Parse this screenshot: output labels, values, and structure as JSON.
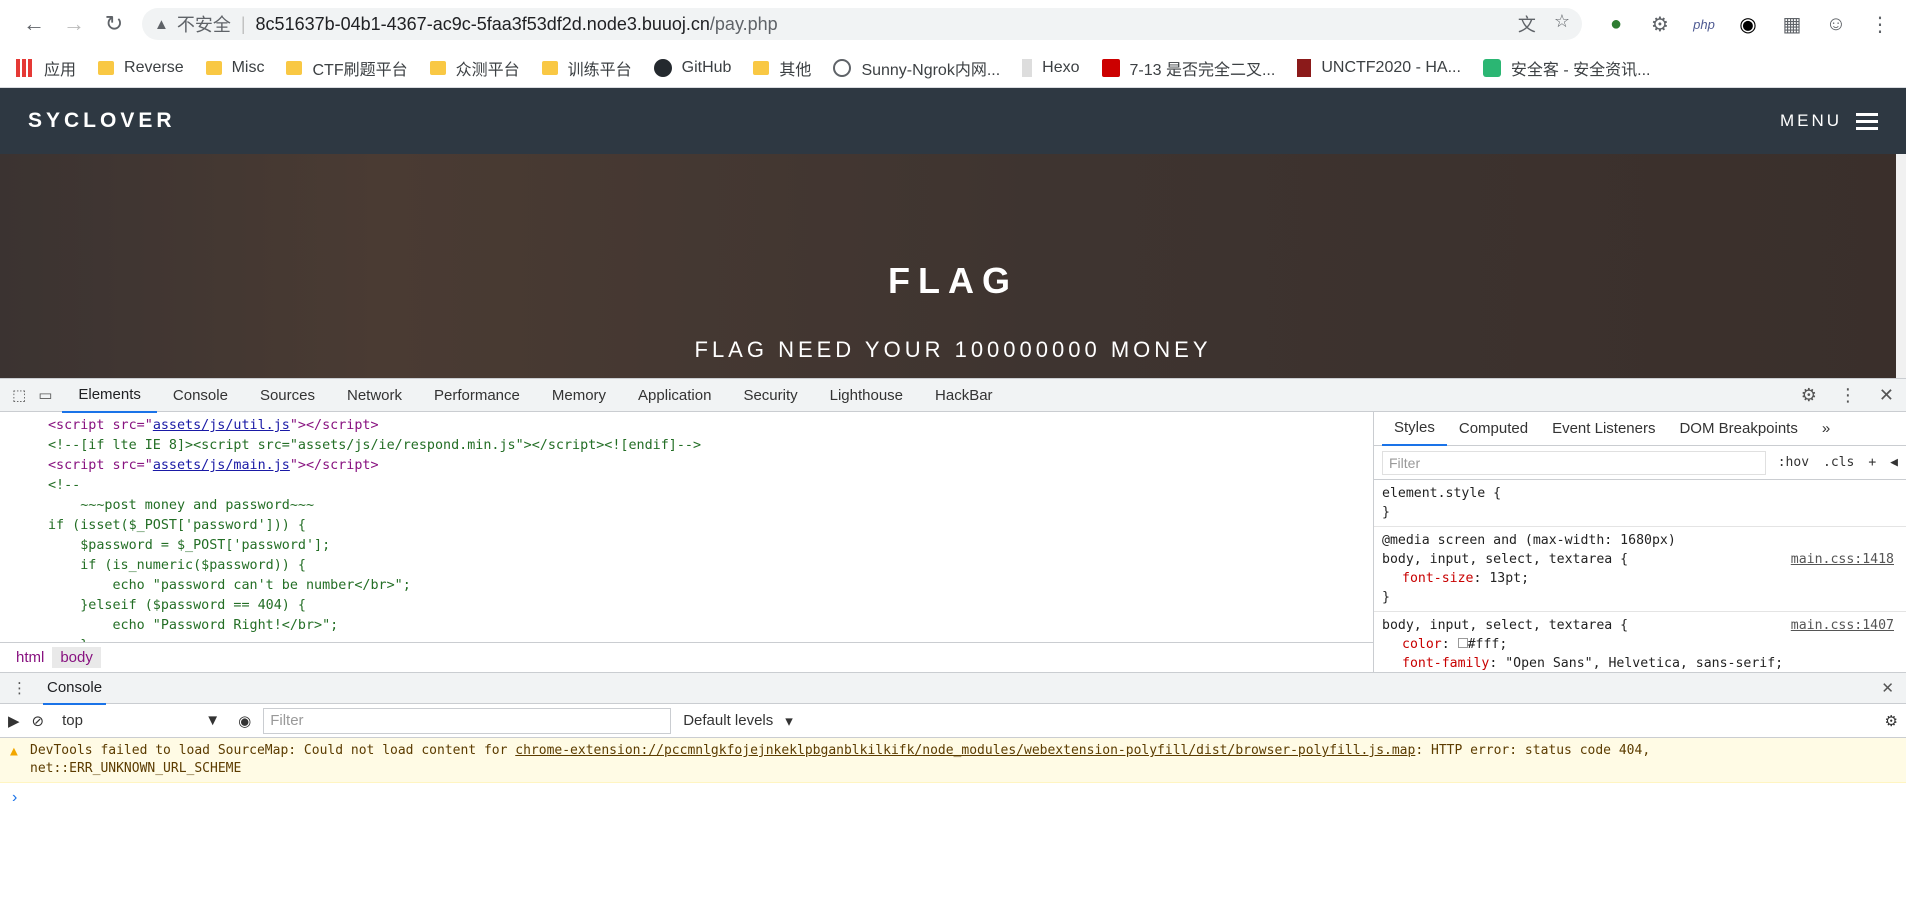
{
  "browser": {
    "insecure_label": "不安全",
    "url_host": "8c51637b-04b1-4367-ac9c-5faa3f53df2d.node3.buuoj.cn",
    "url_path": "/pay.php",
    "bookmarks": [
      "应用",
      "Reverse",
      "Misc",
      "CTF刷题平台",
      "众测平台",
      "训练平台",
      "GitHub",
      "其他",
      "Sunny-Ngrok内网...",
      "Hexo",
      "7-13 是否完全二叉...",
      "UNCTF2020 - HA...",
      "安全客 - 安全资讯..."
    ]
  },
  "site": {
    "logo": "SYCLOVER",
    "menu": "MENU",
    "title": "FLAG",
    "subtitle": "FLAG NEED YOUR 100000000 MONEY"
  },
  "devtools": {
    "tabs": [
      "Elements",
      "Console",
      "Sources",
      "Network",
      "Performance",
      "Memory",
      "Application",
      "Security",
      "Lighthouse",
      "HackBar"
    ],
    "breadcrumbs": [
      "html",
      "body"
    ],
    "styles_tabs": [
      "Styles",
      "Computed",
      "Event Listeners",
      "DOM Breakpoints"
    ],
    "styles_filter_placeholder": "Filter",
    "hov": ":hov",
    "cls": ".cls",
    "element_style": "element.style {",
    "media": "@media screen and (max-width: 1680px)",
    "rule1_selector": "body, input, select, textarea {",
    "rule1_src": "main.css:1418",
    "rule1_prop": "font-size",
    "rule1_val": "13pt;",
    "rule2_selector": "body, input, select, textarea {",
    "rule2_src": "main.css:1407",
    "rule2_prop1": "color",
    "rule2_val1": "#fff;",
    "rule2_prop2": "font-family",
    "rule2_val2": "\"Open Sans\", Helvetica, sans-serif;"
  },
  "console": {
    "drawer_tab": "Console",
    "context": "top",
    "filter_placeholder": "Filter",
    "levels": "Default levels",
    "warning_prefix": "DevTools failed to load SourceMap: Could not load content for ",
    "warning_link": "chrome-extension://pccmnlgkfojejnkeklpbganblkilkifk/node_modules/webextension-polyfill/dist/browser-polyfill.js.map",
    "warning_suffix": ": HTTP error: status code 404,",
    "warning_line2": "net::ERR_UNKNOWN_URL_SCHEME"
  }
}
